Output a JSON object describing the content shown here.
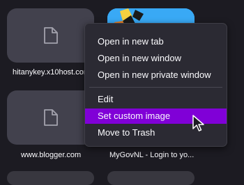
{
  "tiles": [
    {
      "label": "hitanykey.x10host.com",
      "icon": "document-icon"
    },
    {
      "label": "",
      "icon": "image-thumbnail"
    },
    {
      "label": "www.blogger.com",
      "icon": "document-icon"
    },
    {
      "label": "MyGovNL - Login to yo...",
      "icon": "document-icon"
    }
  ],
  "context_menu": {
    "items": [
      {
        "label": "Open in new tab"
      },
      {
        "label": "Open in new window"
      },
      {
        "label": "Open in new private window"
      },
      {
        "label": "Edit"
      },
      {
        "label": "Set custom image",
        "highlighted": true
      },
      {
        "label": "Move to Trash"
      }
    ]
  },
  "colors": {
    "background": "#1c1b22",
    "tile": "#42414d",
    "menu": "#2b2a33",
    "highlight": "#8000d7",
    "text": "#fbfbfe",
    "thumb_blue": "#39a9f5"
  }
}
